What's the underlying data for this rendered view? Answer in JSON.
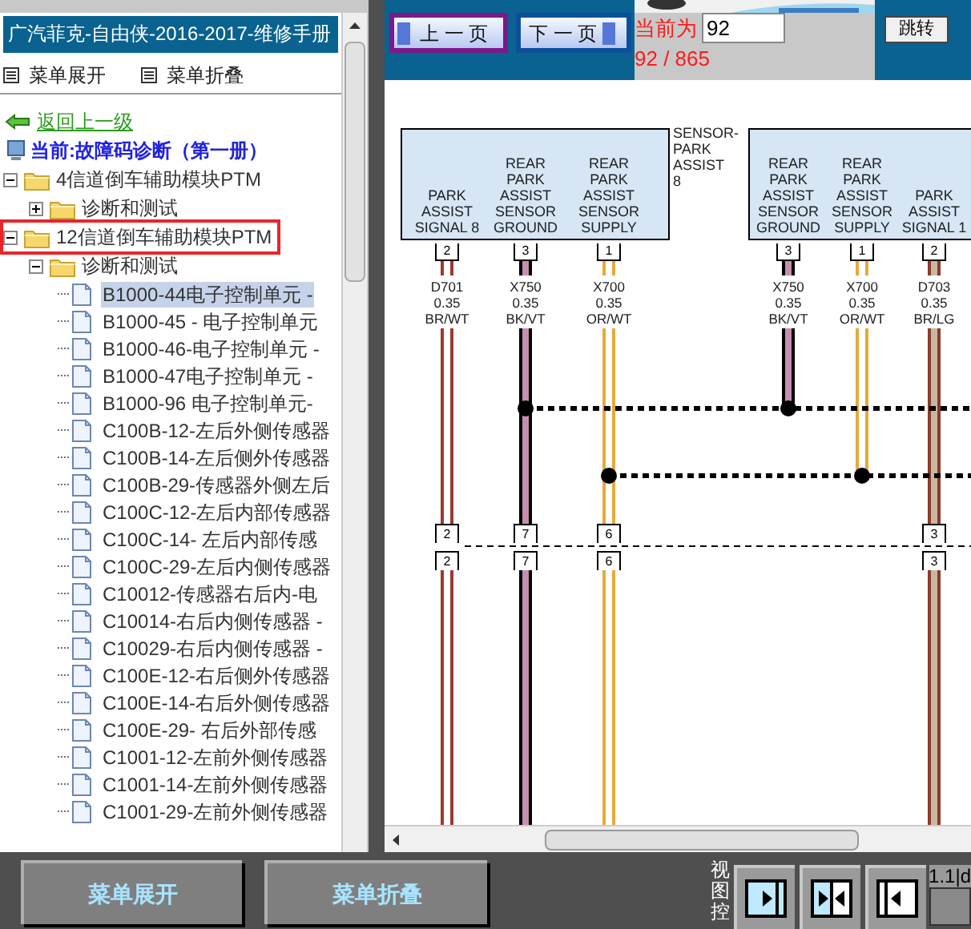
{
  "title": "广汽菲克-自由侠-2016-2017-维修手册",
  "menu_actions": [
    "菜单展开",
    "菜单折叠"
  ],
  "back_link": "返回上一级",
  "current": "当前:故障码诊断（第一册）",
  "tree": [
    {
      "label": "4信道倒车辅助模块PTM",
      "kind": "folder",
      "expanded": true,
      "highlighted": false,
      "children": [
        {
          "label": "诊断和测试",
          "kind": "folder",
          "expanded": false,
          "highlighted": false
        }
      ]
    },
    {
      "label": "12信道倒车辅助模块PTM",
      "kind": "folder",
      "expanded": true,
      "highlighted": true,
      "children": [
        {
          "label": "诊断和测试",
          "kind": "folder",
          "expanded": true,
          "highlighted": false,
          "children": [
            {
              "label": "B1000-44电子控制单元 -",
              "kind": "doc",
              "selected": true
            },
            {
              "label": "B1000-45 - 电子控制单元",
              "kind": "doc",
              "selected": false
            },
            {
              "label": "B1000-46-电子控制单元 -",
              "kind": "doc",
              "selected": false
            },
            {
              "label": "B1000-47电子控制单元 -",
              "kind": "doc",
              "selected": false
            },
            {
              "label": "B1000-96 电子控制单元-",
              "kind": "doc",
              "selected": false
            },
            {
              "label": "C100B-12-左后外侧传感器",
              "kind": "doc",
              "selected": false
            },
            {
              "label": "C100B-14-左后侧外传感器",
              "kind": "doc",
              "selected": false
            },
            {
              "label": "C100B-29-传感器外侧左后",
              "kind": "doc",
              "selected": false
            },
            {
              "label": "C100C-12-左后内部传感器",
              "kind": "doc",
              "selected": false
            },
            {
              "label": "C100C-14- 左后内部传感",
              "kind": "doc",
              "selected": false
            },
            {
              "label": "C100C-29-左后内侧传感器",
              "kind": "doc",
              "selected": false
            },
            {
              "label": "C10012-传感器右后内-电",
              "kind": "doc",
              "selected": false
            },
            {
              "label": "C10014-右后内侧传感器 -",
              "kind": "doc",
              "selected": false
            },
            {
              "label": "C10029-右后内侧传感器 -",
              "kind": "doc",
              "selected": false
            },
            {
              "label": "C100E-12-右后侧外传感器",
              "kind": "doc",
              "selected": false
            },
            {
              "label": "C100E-14-右后外侧传感器",
              "kind": "doc",
              "selected": false
            },
            {
              "label": "C100E-29- 右后外部传感",
              "kind": "doc",
              "selected": false
            },
            {
              "label": "C1001-12-左前外侧传感器",
              "kind": "doc",
              "selected": false
            },
            {
              "label": "C1001-14-左前外侧传感器",
              "kind": "doc",
              "selected": false
            },
            {
              "label": "C1001-29-左前外侧传感器",
              "kind": "doc",
              "selected": false
            }
          ]
        }
      ]
    }
  ],
  "pager": {
    "prev": "上 一 页",
    "next": "下 一 页",
    "current_label": "当前为",
    "page_input": "92",
    "jump": "跳转",
    "page_count": "92 / 865"
  },
  "diagram": {
    "modules": [
      {
        "name_lines": [
          "SENSOR-",
          "PARK",
          "ASSIST",
          "8"
        ],
        "pins": [
          {
            "kind": "through",
            "label_lines": [
              "PARK",
              "ASSIST",
              "SIGNAL 8"
            ],
            "pin": "2",
            "circuit": "D701",
            "gauge": "0.35",
            "wire": "BR/WT",
            "color": "#9c3a2e",
            "inline_pins": [
              "2",
              "2"
            ]
          },
          {
            "kind": "upper_splice_through",
            "label_lines": [
              "REAR",
              "PARK",
              "ASSIST",
              "SENSOR",
              "GROUND"
            ],
            "pin": "3",
            "circuit": "X750",
            "gauge": "0.35",
            "wire": "BK/VT",
            "color": "#000000",
            "stripe": {
              "color": "#c58fb0"
            },
            "inline_pins": [
              "7",
              "7"
            ]
          },
          {
            "kind": "lower_splice_through",
            "label_lines": [
              "REAR",
              "PARK",
              "ASSIST",
              "SENSOR",
              "SUPPLY"
            ],
            "pin": "1",
            "circuit": "X700",
            "gauge": "0.35",
            "wire": "OR/WT",
            "color": "#e8a93a",
            "inline_pins": [
              "6",
              "6"
            ]
          }
        ]
      },
      {
        "pins": [
          {
            "kind": "upper_splice_end",
            "label_lines": [
              "REAR",
              "PARK",
              "ASSIST",
              "SENSOR",
              "GROUND"
            ],
            "pin": "3",
            "circuit": "X750",
            "gauge": "0.35",
            "wire": "BK/VT",
            "color": "#000000",
            "stripe": {
              "color": "#c58fb0"
            }
          },
          {
            "kind": "lower_splice_end",
            "label_lines": [
              "REAR",
              "PARK",
              "ASSIST",
              "SENSOR",
              "SUPPLY"
            ],
            "pin": "1",
            "circuit": "X700",
            "gauge": "0.35",
            "wire": "OR/WT",
            "color": "#e8a93a"
          },
          {
            "kind": "through",
            "label_lines": [
              "PARK",
              "ASSIST",
              "SIGNAL 1"
            ],
            "pin": "2",
            "circuit": "D703",
            "gauge": "0.35",
            "wire": "BR/LG",
            "color": "#8a3b2b",
            "stripe": {
              "color": "#c8b8a0"
            },
            "inline_pins": [
              "3",
              "3"
            ]
          }
        ]
      }
    ]
  },
  "bottom_buttons": [
    "菜单展开",
    "菜单折叠"
  ],
  "view_label": "视图控",
  "view_buttons": [
    {
      "kind": "right"
    },
    {
      "kind": "both"
    },
    {
      "kind": "left"
    }
  ],
  "version": "1.1|d"
}
